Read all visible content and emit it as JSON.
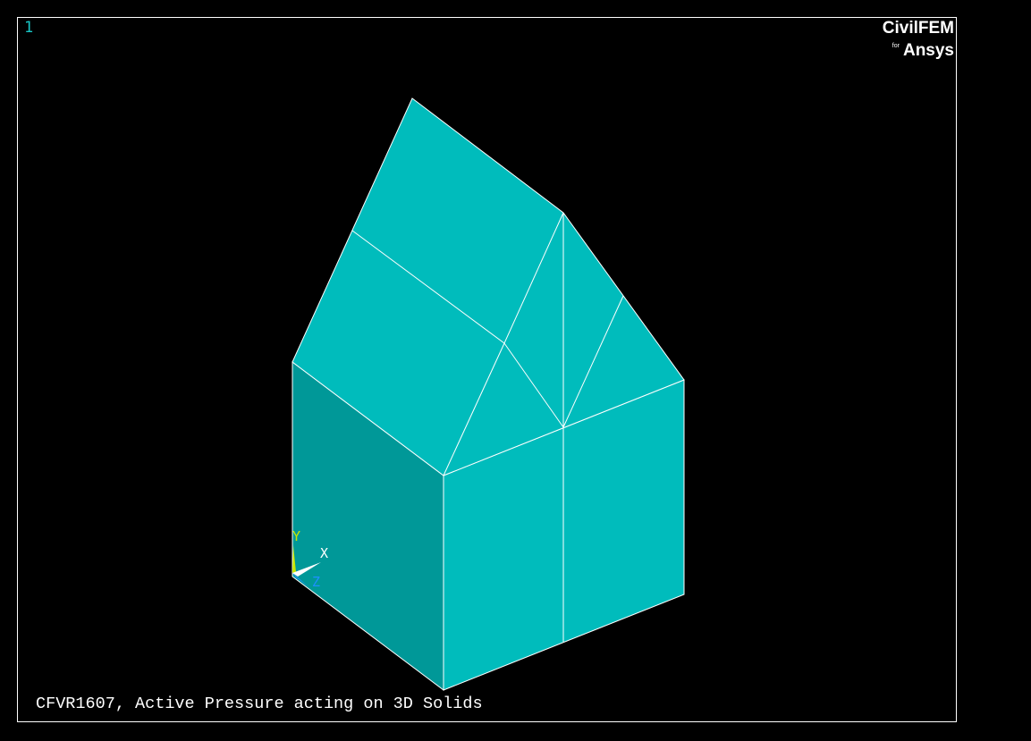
{
  "window": {
    "number": "1"
  },
  "logo": {
    "brand": "CivilFEM",
    "for": "for",
    "product": "Ansys"
  },
  "caption": "CFVR1607, Active Pressure acting on 3D Solids",
  "triad": {
    "x_label": "X",
    "y_label": "Y",
    "z_label": "Z"
  },
  "colors": {
    "background": "#000000",
    "solid_face": "#00bcbc",
    "solid_side": "#009898",
    "edges": "#ffffff",
    "window_number": "#19c6c6",
    "triad_y": "#c8e600",
    "triad_z": "#1e90ff"
  }
}
